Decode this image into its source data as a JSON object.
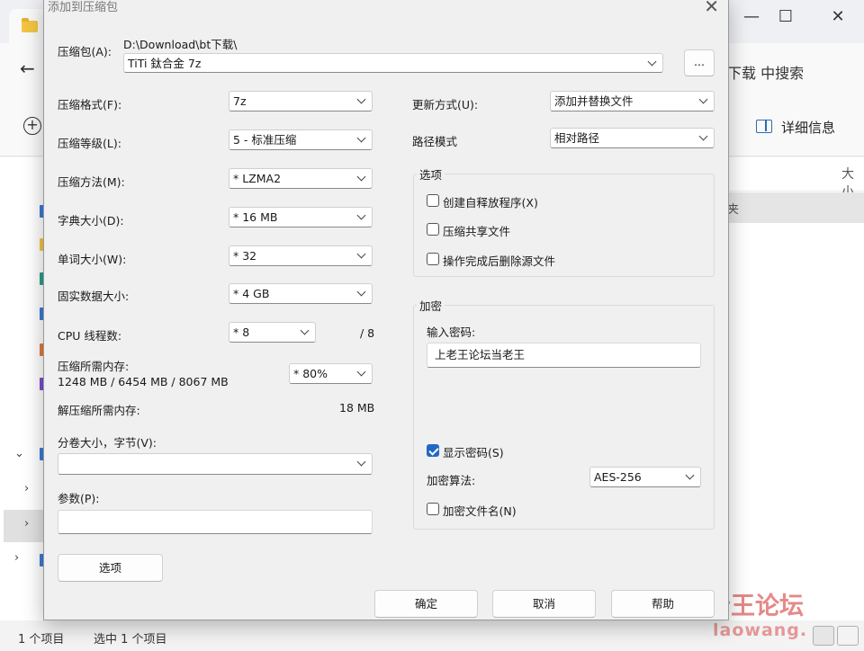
{
  "background": {
    "title_fragment": "| / \\ \\",
    "search_text": "下载 中搜索",
    "details_label": "详细信息",
    "column_size": "大小",
    "selected_row_text": "夹",
    "status_items": "1 个项目",
    "status_selected": "选中 1 个项目"
  },
  "watermark": {
    "text": "老王论坛",
    "sub": "laowang."
  },
  "dialog": {
    "title": "添加到压缩包",
    "close_icon": "close-icon",
    "archive_label": "压缩包(A):",
    "archive_path": "D:\\Download\\bt下载\\",
    "archive_name": "TiTi 鈦合金 7z",
    "browse_label": "...",
    "format_label": "压缩格式(F):",
    "format_value": "7z",
    "level_label": "压缩等级(L):",
    "level_value": "5 - 标准压缩",
    "method_label": "压缩方法(M):",
    "method_value": "* LZMA2",
    "dict_label": "字典大小(D):",
    "dict_value": "* 16 MB",
    "word_label": "单词大小(W):",
    "word_value": "* 32",
    "solid_label": "固实数据大小:",
    "solid_value": "* 4 GB",
    "cpu_label": "CPU 线程数:",
    "cpu_value": "* 8",
    "cpu_max": "/ 8",
    "mem_label": "压缩所需内存:",
    "mem_detail": "1248 MB / 6454 MB / 8067 MB",
    "mem_value": "* 80%",
    "decomp_label": "解压缩所需内存:",
    "decomp_value": "18 MB",
    "split_label": "分卷大小，字节(V):",
    "split_value": "",
    "params_label": "参数(P):",
    "params_value": "",
    "options_btn": "选项",
    "update_label": "更新方式(U):",
    "update_value": "添加并替换文件",
    "path_label": "路径模式",
    "path_value": "相对路径",
    "options_group": "选项",
    "opt_sfx": "创建自释放程序(X)",
    "opt_shared": "压缩共享文件",
    "opt_delete": "操作完成后删除源文件",
    "enc_group": "加密",
    "pwd_label": "输入密码:",
    "pwd_value": "上老王论坛当老王",
    "show_pwd": "显示密码(S)",
    "enc_method_label": "加密算法:",
    "enc_method_value": "AES-256",
    "enc_names": "加密文件名(N)",
    "ok": "确定",
    "cancel": "取消",
    "help": "帮助"
  }
}
